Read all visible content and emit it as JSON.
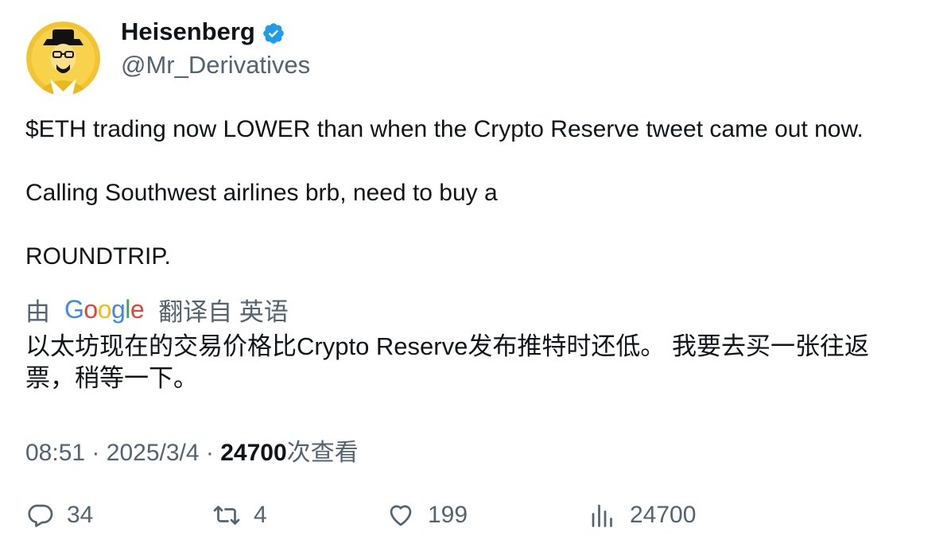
{
  "author": {
    "name": "Heisenberg",
    "handle": "@Mr_Derivatives"
  },
  "tweet": {
    "text": "$ETH trading now LOWER than when the Crypto Reserve tweet came out now.\n\nCalling Southwest airlines brb, need to buy a\n\nROUNDTRIP."
  },
  "translation": {
    "prefix": "由",
    "provider": "Google",
    "suffix": "翻译自 英语",
    "text": "以太坊现在的交易价格比Crypto Reserve发布推特时还低。 我要去买一张往返票，稍等一下。"
  },
  "meta": {
    "time": "08:51",
    "separator": "·",
    "date": "2025/3/4",
    "views_count": "24700",
    "views_label": "次查看"
  },
  "actions": {
    "replies": "34",
    "retweets": "4",
    "likes": "199",
    "views": "24700"
  },
  "colors": {
    "verified": "#1d9bf0",
    "muted": "#536471",
    "text": "#0f1419"
  }
}
